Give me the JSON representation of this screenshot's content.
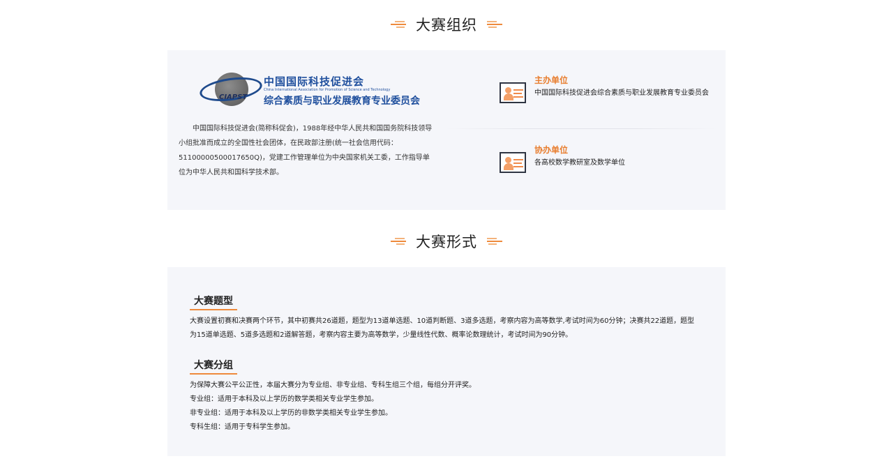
{
  "organization": {
    "title": "大赛组织",
    "logo": {
      "abbr": "CIAPST",
      "name_cn": "中国国际科技促进会",
      "name_en": "China International Association for Promotion of Science and Technology",
      "committee_cn": "综合素质与职业发展教育专业委员会"
    },
    "description": "中国国际科技促进会(简称科促会)，1988年经中华人民共和国国务院科技领导小组批准而成立的全国性社会团体，在民政部注册(统一社会信用代码：51100000500017650Q)，党建工作管理单位为中央国家机关工委，工作指导单位为中华人民共和国科学技术部。",
    "host": {
      "label": "主办单位",
      "text": "中国国际科技促进会综合素质与职业发展教育专业委员会"
    },
    "co_host": {
      "label": "协办单位",
      "text": "各高校数学教研室及数学单位"
    }
  },
  "format": {
    "title": "大赛形式",
    "question_type": {
      "heading": "大赛题型",
      "text": "大赛设置初赛和决赛两个环节，其中初赛共26道题，题型为13道单选题、10道判断题、3道多选题，考察内容为高等数学,考试时间为60分钟；决赛共22道题，题型为15道单选题、5道多选题和2道解答题，考察内容主要为高等数学，少量线性代数、概率论数理统计，考试时间为90分钟。"
    },
    "grouping": {
      "heading": "大赛分组",
      "lines": [
        "为保障大赛公平公正性，本届大赛分为专业组、非专业组、专科生组三个组，每组分开评奖。",
        "专业组：适用于本科及以上学历的数学类相关专业学生参加。",
        "非专业组：适用于本科及以上学历的非数学类相关专业学生参加。",
        "专科生组：适用于专科学生参加。"
      ]
    }
  },
  "colors": {
    "accent": "#ee8a3c",
    "brand_blue": "#1f4f9d",
    "panel_bg": "#f5f6fa"
  }
}
